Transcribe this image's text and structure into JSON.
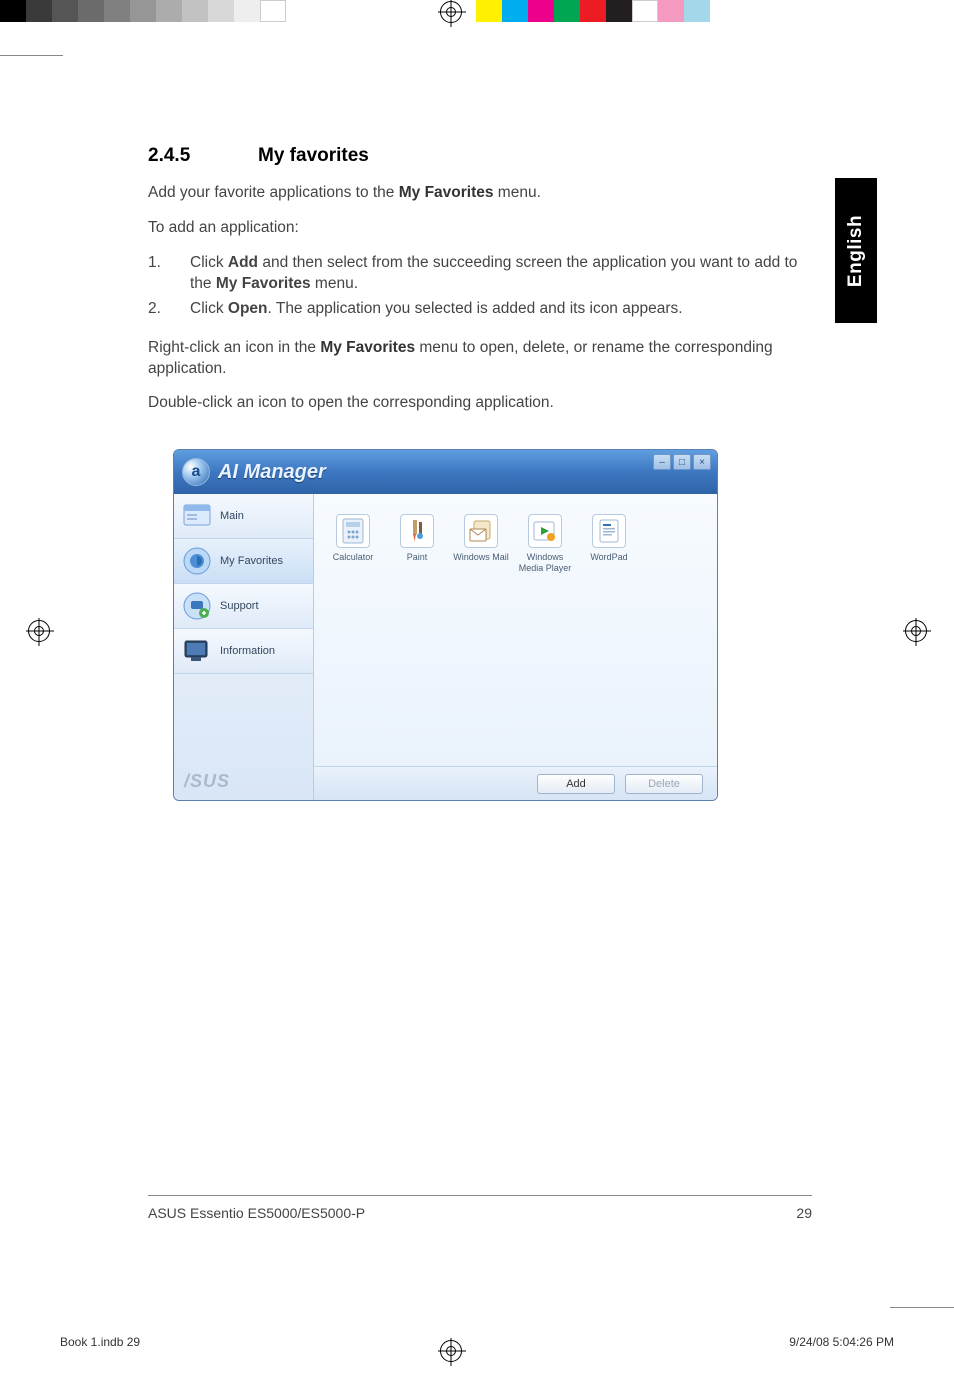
{
  "section": {
    "number": "2.4.5",
    "title": "My favorites"
  },
  "intro": {
    "line1_a": "Add your favorite applications to the ",
    "line1_bold": "My Favorites",
    "line1_b": " menu.",
    "line2": "To add an application:"
  },
  "steps": [
    {
      "n": "1.",
      "pre": "Click ",
      "b1": "Add",
      "mid": " and then select from the succeeding screen the application you want to add to the ",
      "b2": "My Favorites",
      "post": " menu."
    },
    {
      "n": "2.",
      "pre": "Click ",
      "b1": "Open",
      "mid": ". The application you selected is added and its icon appears.",
      "b2": "",
      "post": ""
    }
  ],
  "para2": {
    "a": "Right-click an icon in the ",
    "b": "My Favorites",
    "c": " menu to open, delete, or rename the corresponding application."
  },
  "para3": "Double-click an icon to open the corresponding application.",
  "lang_tab": "English",
  "ai": {
    "title": "AI Manager",
    "logo_letter": "a",
    "winbtns": {
      "min": "–",
      "max": "□",
      "close": "×"
    },
    "sidebar": [
      {
        "label": "Main"
      },
      {
        "label": "My Favorites"
      },
      {
        "label": "Support"
      },
      {
        "label": "Information"
      }
    ],
    "brand": "/SUS",
    "apps": [
      {
        "label": "Calculator"
      },
      {
        "label": "Paint"
      },
      {
        "label": "Windows Mail"
      },
      {
        "label": "Windows Media Player"
      },
      {
        "label": "WordPad"
      }
    ],
    "buttons": {
      "add": "Add",
      "delete": "Delete"
    }
  },
  "footer": {
    "product": "ASUS Essentio ES5000/ES5000-P",
    "page": "29"
  },
  "slug": {
    "file": "Book 1.indb   29",
    "datetime": "9/24/08   5:04:26 PM"
  },
  "colorbar": [
    "#000",
    "#3a3a3a",
    "#555",
    "#6b6b6b",
    "#808080",
    "#969696",
    "#acacac",
    "#c2c2c2",
    "#d8d8d8",
    "#eee",
    "#fff",
    "#fff100",
    "#00aeef",
    "#ec008c",
    "#00a651",
    "#ed1c24",
    "#231f20",
    "#fff",
    "#f49ac1",
    "#a3d7e9"
  ]
}
